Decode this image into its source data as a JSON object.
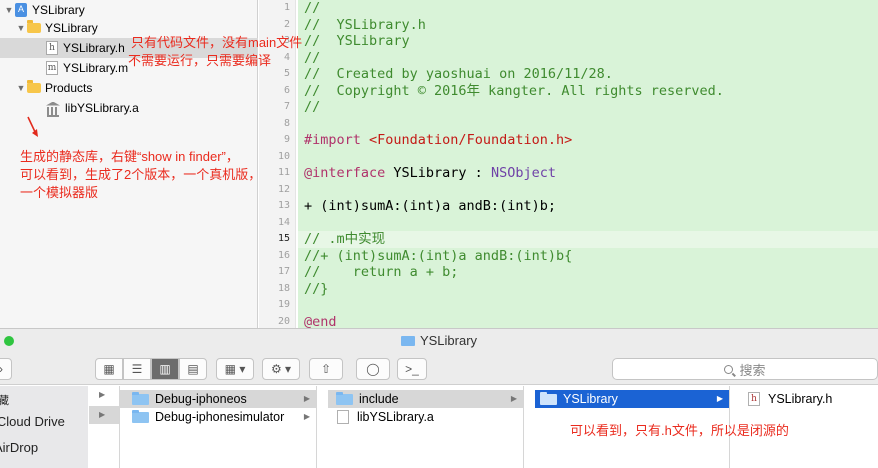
{
  "navigator": {
    "project": "YSLibrary",
    "group": "YSLibrary",
    "file_h": "YSLibrary.h",
    "file_h_icon": "h",
    "file_m": "YSLibrary.m",
    "file_m_icon": "m",
    "products": "Products",
    "product_lib": "libYSLibrary.a"
  },
  "annotations": {
    "top_line1": "只有代码文件，没有main文件",
    "top_line2": "不需要运行，只需要编译",
    "mid_line1": "生成的静态库，右键“show in finder”，",
    "mid_line2": "可以看到，生成了2个版本，一个真机版，",
    "mid_line3": "一个模拟器版",
    "bottom": "可以看到，只有.h文件，所以是闭源的"
  },
  "editor": {
    "lines": [
      {
        "n": "1",
        "t": "//"
      },
      {
        "n": "2",
        "t": "//  YSLibrary.h"
      },
      {
        "n": "3",
        "t": "//  YSLibrary"
      },
      {
        "n": "4",
        "t": "//"
      },
      {
        "n": "5",
        "t": "//  Created by yaoshuai on 2016/11/28."
      },
      {
        "n": "6",
        "t": "//  Copyright © 2016年 kangter. All rights reserved."
      },
      {
        "n": "7",
        "t": "//"
      },
      {
        "n": "8",
        "t": ""
      },
      {
        "n": "9",
        "t_kw": "#import ",
        "t_str": "<Foundation/Foundation.h>"
      },
      {
        "n": "10",
        "t": ""
      },
      {
        "n": "11",
        "t_kw": "@interface",
        "t_pl": " YSLibrary : ",
        "t_ty": "NSObject"
      },
      {
        "n": "12",
        "t": ""
      },
      {
        "n": "13",
        "t": "+ (int)sumA:(int)a andB:(int)b;"
      },
      {
        "n": "14",
        "t": ""
      },
      {
        "n": "15",
        "t": "// .m中实现"
      },
      {
        "n": "16",
        "t": "//+ (int)sumA:(int)a andB:(int)b{"
      },
      {
        "n": "17",
        "t": "//    return a + b;"
      },
      {
        "n": "18",
        "t": "//}"
      },
      {
        "n": "19",
        "t": ""
      },
      {
        "n": "20",
        "t": "@end"
      }
    ]
  },
  "finder": {
    "title": "YSLibrary",
    "search_placeholder": "搜索",
    "sidebar": [
      "藏",
      "iCloud Drive",
      "AirDrop"
    ],
    "col1": [
      "Debug-iphoneos",
      "Debug-iphonesimulator"
    ],
    "col2": [
      "include",
      "libYSLibrary.a"
    ],
    "col3": [
      "YSLibrary"
    ],
    "col4": [
      "YSLibrary.h"
    ]
  }
}
